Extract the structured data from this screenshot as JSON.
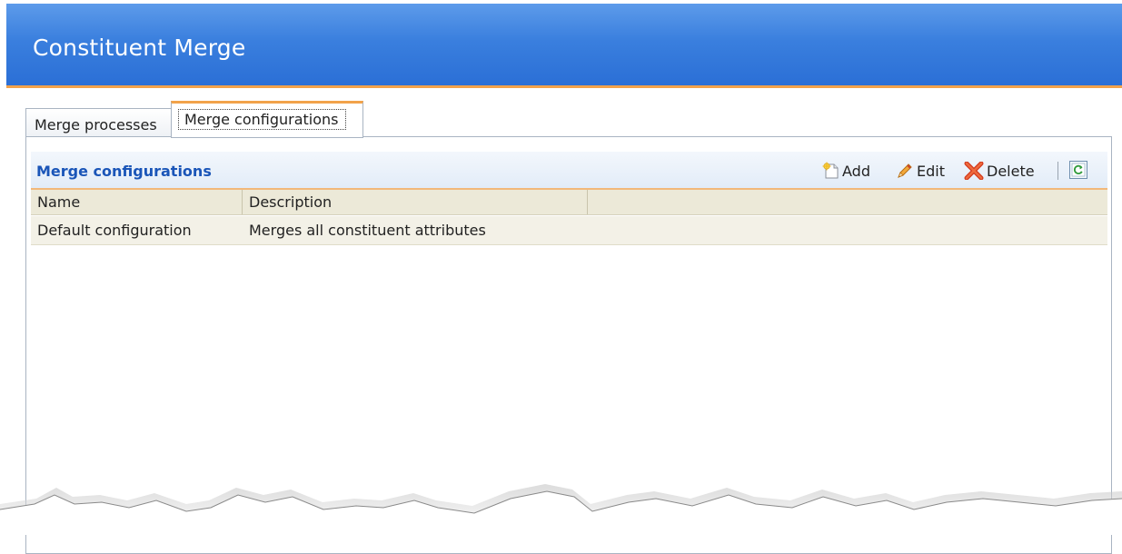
{
  "page": {
    "title": "Constituent Merge"
  },
  "tabs": [
    {
      "label": "Merge processes",
      "active": false
    },
    {
      "label": "Merge configurations",
      "active": true
    }
  ],
  "section": {
    "title": "Merge configurations",
    "toolbar": {
      "add_label": "Add",
      "edit_label": "Edit",
      "delete_label": "Delete",
      "icons": [
        "add-icon",
        "edit-pencil-icon",
        "delete-x-icon",
        "refresh-icon"
      ]
    }
  },
  "grid": {
    "columns": [
      "Name",
      "Description"
    ],
    "rows": [
      {
        "name": "Default configuration",
        "description": "Merges all constituent attributes"
      }
    ]
  },
  "colors": {
    "header_blue": "#3a7fde",
    "accent_orange": "#f2a24a",
    "section_title_blue": "#1a55b8",
    "grid_header_beige": "#ece9d8"
  }
}
